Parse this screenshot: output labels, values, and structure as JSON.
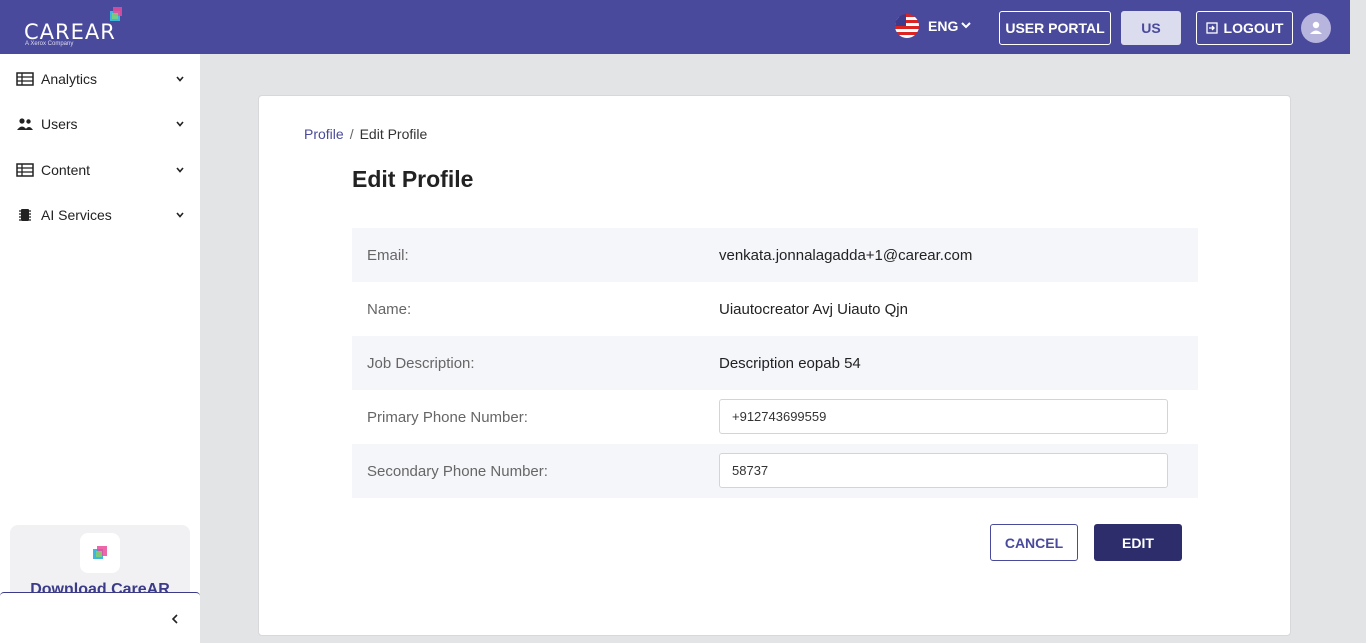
{
  "header": {
    "logo_text": "CAREAR",
    "logo_subtext": "A Xerox Company",
    "language": "ENG",
    "user_portal_label": "USER PORTAL",
    "region_label": "US",
    "logout_label": "LOGOUT",
    "brand_color": "#4a4a9c"
  },
  "sidebar": {
    "items": [
      {
        "label": "Analytics",
        "icon": "table-icon"
      },
      {
        "label": "Users",
        "icon": "users-icon"
      },
      {
        "label": "Content",
        "icon": "table-icon"
      },
      {
        "label": "AI Services",
        "icon": "chip-icon"
      }
    ],
    "download_label": "Download CareAR"
  },
  "breadcrumb": {
    "parent": "Profile",
    "separator": "/",
    "current": "Edit Profile"
  },
  "page": {
    "title": "Edit Profile"
  },
  "profile": {
    "email_label": "Email:",
    "email_value": "venkata.jonnalagadda+1@carear.com",
    "name_label": "Name:",
    "name_value": "Uiautocreator Avj Uiauto Qjn",
    "job_label": "Job Description:",
    "job_value": "Description eopab 54",
    "primary_phone_label": "Primary Phone Number:",
    "primary_phone_value": "+912743699559",
    "secondary_phone_label": "Secondary Phone Number:",
    "secondary_phone_value": "58737"
  },
  "actions": {
    "cancel_label": "CANCEL",
    "edit_label": "EDIT"
  }
}
